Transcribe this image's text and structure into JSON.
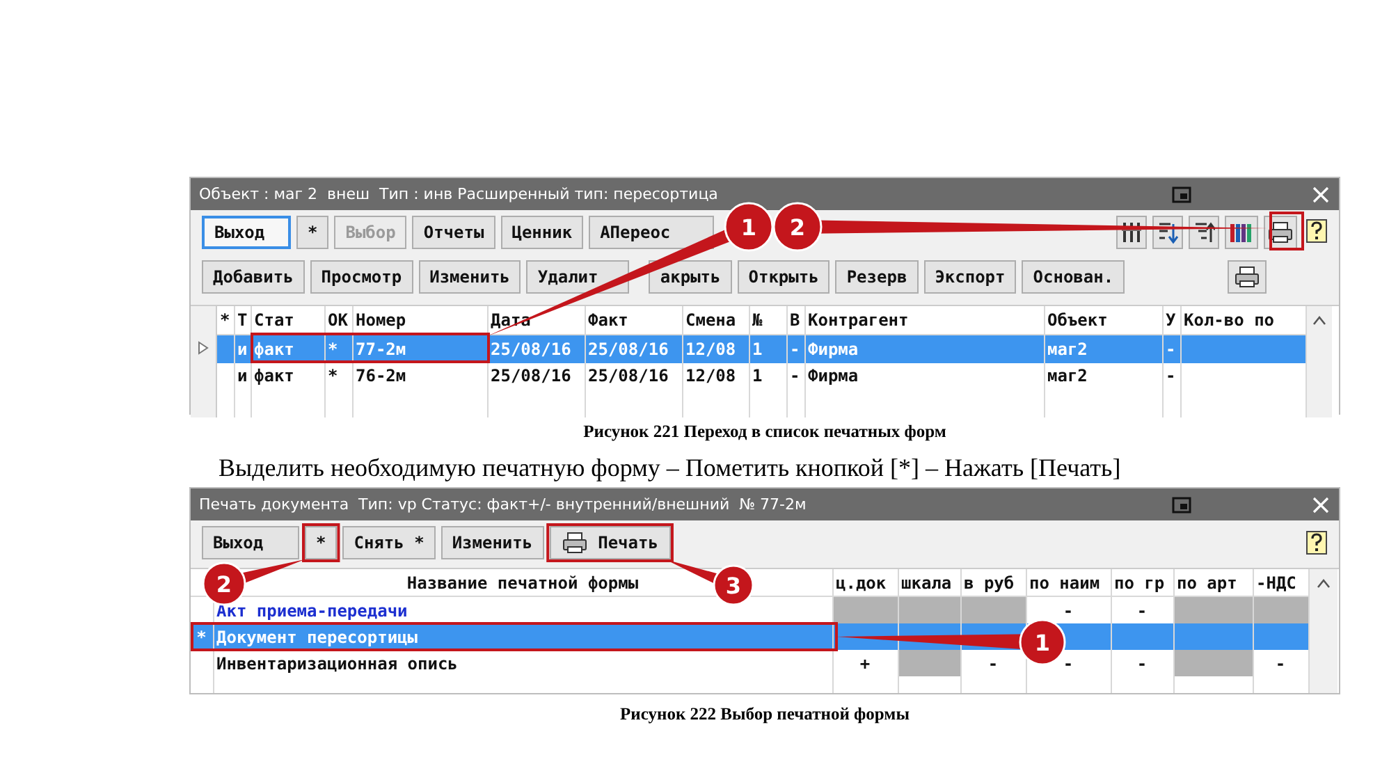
{
  "screen_1": {
    "title": "Объект : маг 2  внеш  Тип : инв Расширенный тип: пересортица",
    "toolbar_row_1": [
      {
        "label": "Выход",
        "focused": true,
        "disabled": false
      },
      {
        "label": "*",
        "focused": false,
        "disabled": false
      },
      {
        "label": "Выбор",
        "focused": false,
        "disabled": true
      },
      {
        "label": "Отчеты",
        "focused": false,
        "disabled": false
      },
      {
        "label": "Ценник",
        "focused": false,
        "disabled": false
      },
      {
        "label": "AПереос",
        "focused": false,
        "disabled": false
      }
    ],
    "toolbar_row_2": [
      {
        "label": "Добавить"
      },
      {
        "label": "Просмотр"
      },
      {
        "label": "Изменить"
      },
      {
        "label": "Удалит"
      },
      {
        "label": "акрыть"
      },
      {
        "label": "Открыть"
      },
      {
        "label": "Резерв"
      },
      {
        "label": "Экспорт"
      },
      {
        "label": "Основан."
      }
    ],
    "columns": [
      "*",
      "Т",
      "Стат",
      "ОК",
      "Номер",
      "Дата",
      "Факт",
      "Смена",
      "№",
      "В",
      "Контрагент",
      "Объект",
      "У",
      "Кол-во по"
    ],
    "rows": [
      {
        "selected": true,
        "cells": [
          "",
          "и",
          "факт",
          "*",
          "77-2м",
          "25/08/16",
          "25/08/16",
          "12/08",
          "1",
          "-",
          "Фирма",
          "маг2",
          "-",
          ""
        ]
      },
      {
        "selected": false,
        "cells": [
          "",
          "и",
          "факт",
          "*",
          "76-2м",
          "25/08/16",
          "25/08/16",
          "12/08",
          "1",
          "-",
          "Фирма",
          "маг2",
          "-",
          ""
        ]
      }
    ],
    "callouts": [
      "1",
      "2"
    ]
  },
  "caption_1": "Рисунок 221 Переход в список печатных форм",
  "instruction": "Выделить необходимую печатную форму – Пометить кнопкой [*] – Нажать [Печать]",
  "screen_2": {
    "title": "Печать документа  Тип: vp Статус: факт+/- внутренний/внешний  № 77-2м",
    "toolbar": [
      {
        "label": "Выход",
        "kind": "text"
      },
      {
        "label": "*",
        "kind": "text"
      },
      {
        "label": "Снять *",
        "kind": "text"
      },
      {
        "label": "Изменить",
        "kind": "text"
      },
      {
        "label": "Печать",
        "kind": "print"
      }
    ],
    "name_header": "Название печатной формы",
    "columns": [
      "ц.док",
      "шкала",
      "в руб",
      "по наим",
      "по гр",
      "по арт",
      "-НДС"
    ],
    "rows": [
      {
        "marker": "",
        "name": "Акт приема-передачи",
        "emphasized": true,
        "selected": false,
        "cells": [
          {
            "disabled": true
          },
          {
            "disabled": true
          },
          {
            "disabled": true
          },
          {
            "text": "-",
            "disabled": false
          },
          {
            "text": "-",
            "disabled": false
          },
          {
            "disabled": true
          },
          {
            "disabled": true
          }
        ]
      },
      {
        "marker": "*",
        "name": "Документ пересортицы",
        "emphasized": false,
        "selected": true
      },
      {
        "marker": "",
        "name": "Инвентаризационная опись",
        "emphasized": false,
        "selected": false,
        "cells": [
          {
            "text": "+",
            "disabled": false
          },
          {
            "disabled": true
          },
          {
            "text": "-",
            "disabled": false
          },
          {
            "text": "-",
            "disabled": false
          },
          {
            "text": "-",
            "disabled": false
          },
          {
            "disabled": true
          },
          {
            "text": "-",
            "disabled": false
          }
        ]
      }
    ],
    "callouts": [
      "2",
      "3",
      "1"
    ]
  },
  "caption_2": "Рисунок 222 Выбор печатной формы"
}
